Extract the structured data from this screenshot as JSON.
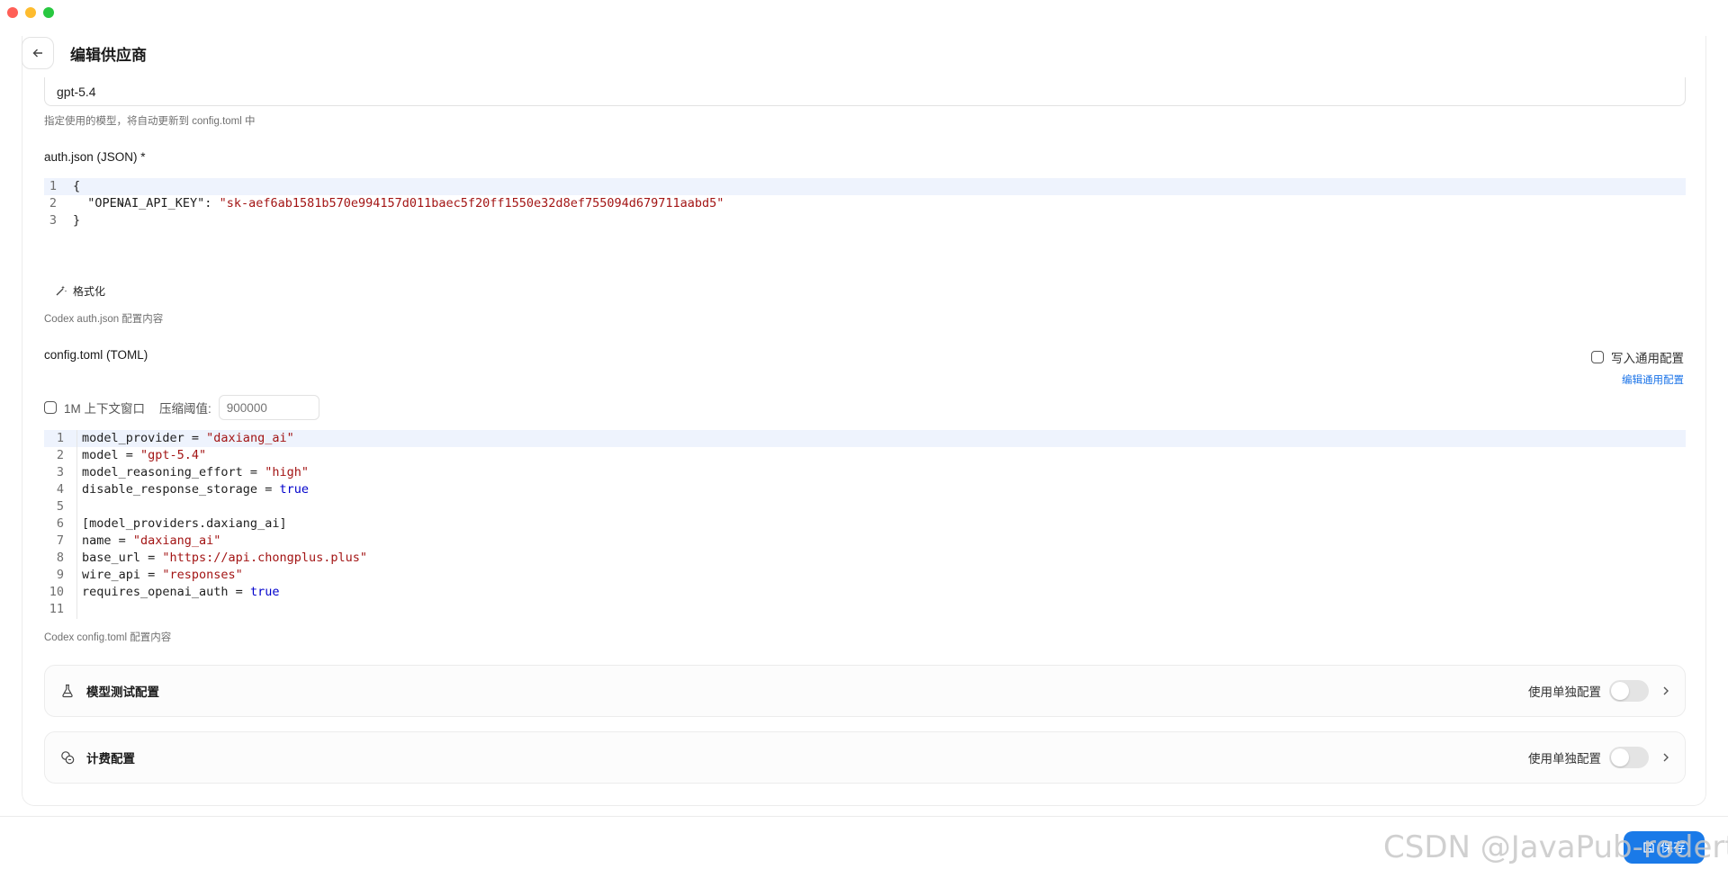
{
  "header": {
    "title": "编辑供应商"
  },
  "model_field": {
    "value": "gpt-5.4",
    "hint": "指定使用的模型，将自动更新到 config.toml 中"
  },
  "auth_json": {
    "label": "auth.json (JSON) *",
    "lines": [
      {
        "num": "1",
        "text": "{"
      },
      {
        "num": "2",
        "key": "  \"OPENAI_API_KEY\": ",
        "str": "\"sk-aef6ab1581b570e994157d011baec5f20ff1550e32d8ef755094d679711aabd5\""
      },
      {
        "num": "3",
        "text": "}"
      }
    ],
    "format_label": "格式化",
    "hint": "Codex auth.json 配置内容"
  },
  "config_toml": {
    "label": "config.toml (TOML)",
    "write_common_label": "写入通用配置",
    "edit_common_label": "编辑通用配置",
    "context_window_label": "1M 上下文窗口",
    "compress_label": "压缩阈值:",
    "compress_placeholder": "900000",
    "lines": [
      {
        "num": "1",
        "key": "model_provider = ",
        "str": "\"daxiang_ai\""
      },
      {
        "num": "2",
        "key": "model = ",
        "str": "\"gpt-5.4\""
      },
      {
        "num": "3",
        "key": "model_reasoning_effort = ",
        "str": "\"high\""
      },
      {
        "num": "4",
        "key": "disable_response_storage = ",
        "bool": "true"
      },
      {
        "num": "5",
        "key": ""
      },
      {
        "num": "6",
        "key": "[model_providers.daxiang_ai]"
      },
      {
        "num": "7",
        "key": "name = ",
        "str": "\"daxiang_ai\""
      },
      {
        "num": "8",
        "key": "base_url = ",
        "str": "\"https://api.chongplus.plus\""
      },
      {
        "num": "9",
        "key": "wire_api = ",
        "str": "\"responses\""
      },
      {
        "num": "10",
        "key": "requires_openai_auth = ",
        "bool": "true"
      },
      {
        "num": "11",
        "key": ""
      }
    ],
    "hint": "Codex config.toml 配置内容"
  },
  "sections": [
    {
      "title": "模型测试配置",
      "toggle_label": "使用单独配置",
      "icon": "flask-icon",
      "enabled": false
    },
    {
      "title": "计费配置",
      "toggle_label": "使用单独配置",
      "icon": "coins-icon",
      "enabled": false
    }
  ],
  "footer": {
    "save_label": "保存"
  },
  "watermark": "CSDN @JavaPub-rodert",
  "colors": {
    "accent": "#1a7ae8",
    "string": "#a31515",
    "boolean": "#0000cc",
    "active_line": "#eef3fd"
  }
}
